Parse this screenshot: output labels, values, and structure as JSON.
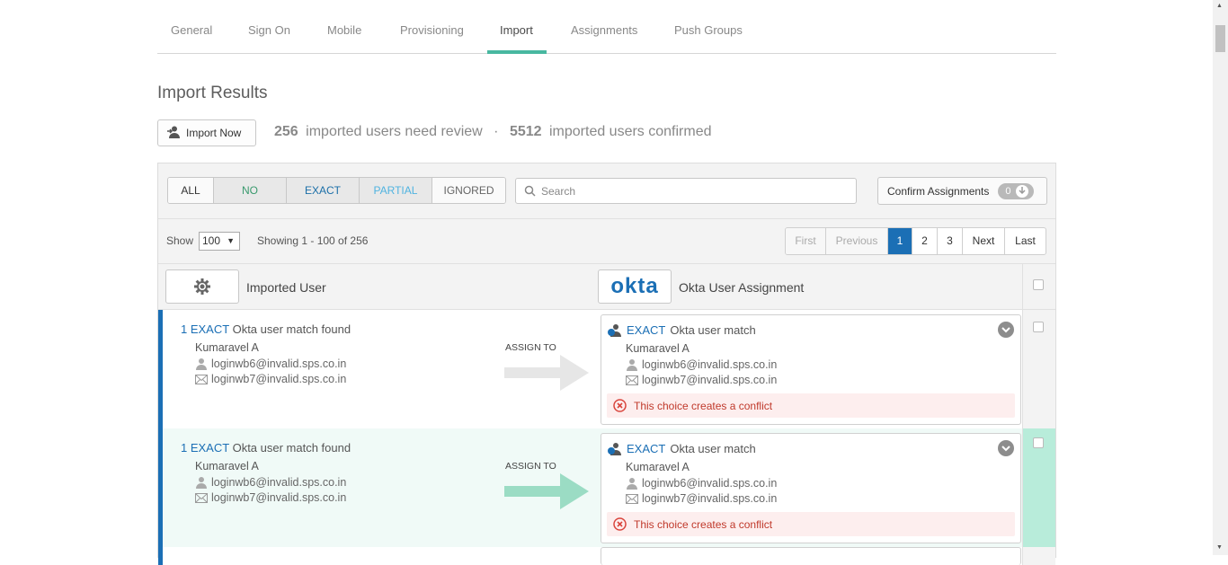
{
  "tabs": [
    {
      "label": "General"
    },
    {
      "label": "Sign On"
    },
    {
      "label": "Mobile"
    },
    {
      "label": "Provisioning"
    },
    {
      "label": "Import"
    },
    {
      "label": "Assignments"
    },
    {
      "label": "Push Groups"
    }
  ],
  "active_tab": "Import",
  "page_title": "Import Results",
  "import_button": "Import Now",
  "summary": {
    "review_count": "256",
    "review_text": "imported users need review",
    "separator": "·",
    "confirmed_count": "5512",
    "confirmed_text": "imported users confirmed"
  },
  "filters": {
    "all": "ALL",
    "no": "NO",
    "exact": "EXACT",
    "partial": "PARTIAL",
    "ignored": "IGNORED"
  },
  "search": {
    "placeholder": "Search",
    "value": ""
  },
  "confirm": {
    "label": "Confirm Assignments",
    "count": "0"
  },
  "show": {
    "label": "Show",
    "value": "100",
    "showing": "Showing 1 - 100 of 256"
  },
  "pagination": {
    "first": "First",
    "previous": "Previous",
    "pages": [
      "1",
      "2",
      "3"
    ],
    "current_page": "1",
    "next": "Next",
    "last": "Last"
  },
  "columns": {
    "imported_user": "Imported User",
    "okta_logo": "okta",
    "okta_assignment": "Okta User Assignment"
  },
  "rows": [
    {
      "match_count": "1 EXACT",
      "match_text": "Okta user match found",
      "name": "Kumaravel A",
      "login": "loginwb6@invalid.sps.co.in",
      "email": "loginwb7@invalid.sps.co.in",
      "assign_label": "ASSIGN TO",
      "card_match": "EXACT",
      "card_match_text": "Okta user match",
      "card_name": "Kumaravel A",
      "card_login": "loginwb6@invalid.sps.co.in",
      "card_email": "loginwb7@invalid.sps.co.in",
      "conflict": "This choice creates a conflict",
      "arrow_color": "#e6e6e6"
    },
    {
      "match_count": "1 EXACT",
      "match_text": "Okta user match found",
      "name": "Kumaravel A",
      "login": "loginwb6@invalid.sps.co.in",
      "email": "loginwb7@invalid.sps.co.in",
      "assign_label": "ASSIGN TO",
      "card_match": "EXACT",
      "card_match_text": "Okta user match",
      "card_name": "Kumaravel A",
      "card_login": "loginwb6@invalid.sps.co.in",
      "card_email": "loginwb7@invalid.sps.co.in",
      "conflict": "This choice creates a conflict",
      "arrow_color": "#9bdcc4"
    }
  ],
  "colors": {
    "accent": "#1b6fb5",
    "tab_underline": "#48b8a0",
    "conflict_text": "#c0392b",
    "row_highlight": "#b8ecda"
  }
}
